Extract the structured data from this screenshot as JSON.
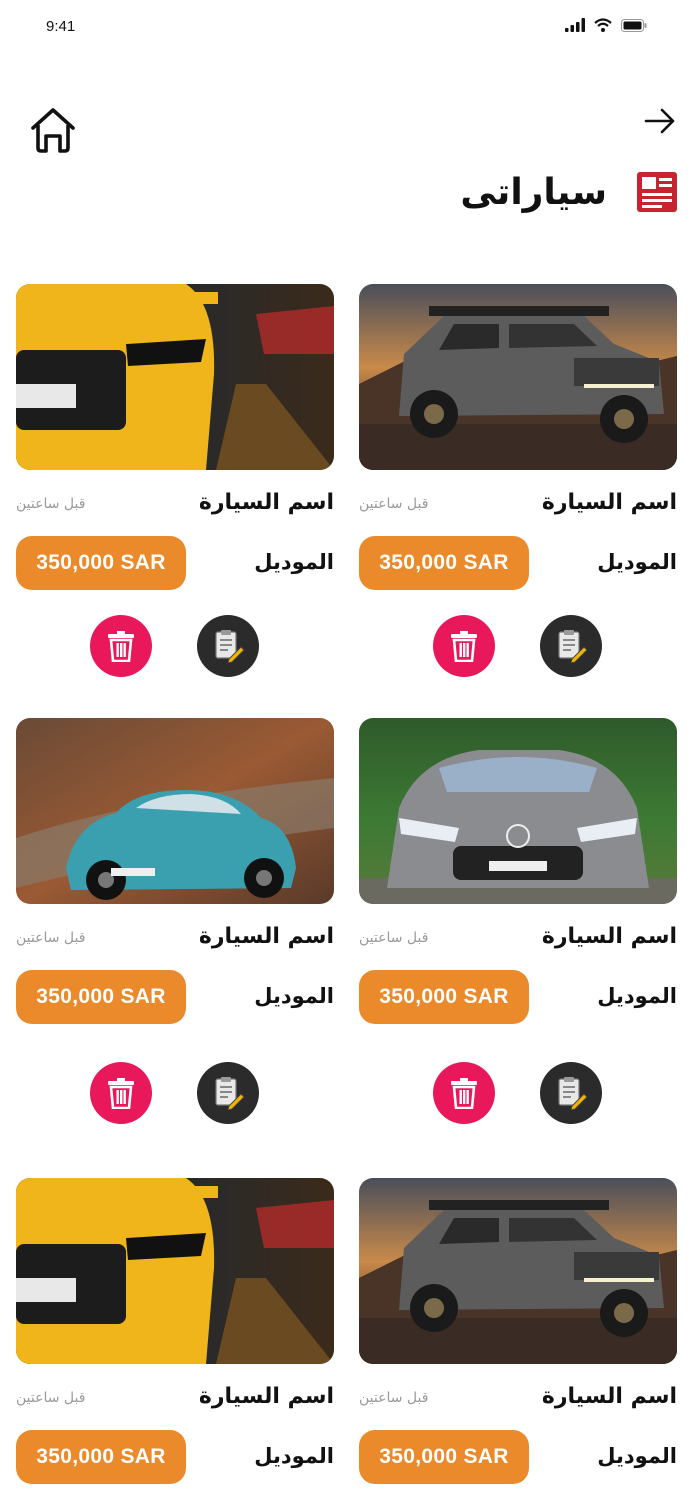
{
  "status_bar": {
    "time": "9:41"
  },
  "header": {
    "title": "سياراتى"
  },
  "cards": [
    {
      "name": "اسم السيارة",
      "time": "قبل ساعتين",
      "model": "الموديل",
      "price": "350,000 SAR",
      "image": "grey-pickup-truck"
    },
    {
      "name": "اسم السيارة",
      "time": "قبل ساعتين",
      "model": "الموديل",
      "price": "350,000 SAR",
      "image": "yellow-coupe"
    },
    {
      "name": "اسم السيارة",
      "time": "قبل ساعتين",
      "model": "الموديل",
      "price": "350,000 SAR",
      "image": "grey-amg-coupe"
    },
    {
      "name": "اسم السيارة",
      "time": "قبل ساعتين",
      "model": "الموديل",
      "price": "350,000 SAR",
      "image": "blue-classic-coupe"
    },
    {
      "name": "اسم السيارة",
      "time": "قبل ساعتين",
      "model": "الموديل",
      "price": "350,000 SAR",
      "image": "grey-pickup-truck"
    },
    {
      "name": "اسم السيارة",
      "time": "قبل ساعتين",
      "model": "الموديل",
      "price": "350,000 SAR",
      "image": "yellow-coupe"
    }
  ],
  "icons": {
    "home": "home-icon",
    "forward": "arrow-right-icon",
    "title": "document-icon",
    "edit": "edit-document-icon",
    "delete": "trash-icon"
  },
  "colors": {
    "price": "#ea8a2a",
    "delete": "#e8185b",
    "edit": "#2b2b2b",
    "title_icon": "#c8242f"
  }
}
